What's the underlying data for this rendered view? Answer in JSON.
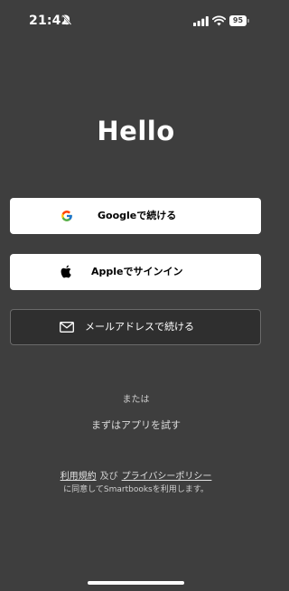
{
  "status_bar": {
    "time": "21:42",
    "battery": "95",
    "icons": [
      "bell-slash-icon",
      "cellular-signal-icon",
      "wifi-icon",
      "battery-icon"
    ]
  },
  "title": "Hello",
  "buttons": {
    "google": {
      "label": "Googleで続ける",
      "icon": "google-icon"
    },
    "apple": {
      "label": "Appleでサインイン",
      "icon": "apple-icon"
    },
    "email": {
      "label": "メールアドレスで続ける",
      "icon": "mail-icon"
    }
  },
  "or_text": "または",
  "try_app": "まずはアプリを試す",
  "terms": {
    "terms_link": "利用規約",
    "and_text": "及び",
    "privacy_link": "プライバシーポリシー",
    "consent": "に同意してSmartbooksを利用します。"
  },
  "colors": {
    "background": "#3e3e3e",
    "light_button": "#ffffff",
    "dark_button": "#2f2f2f",
    "text": "#ffffff"
  }
}
